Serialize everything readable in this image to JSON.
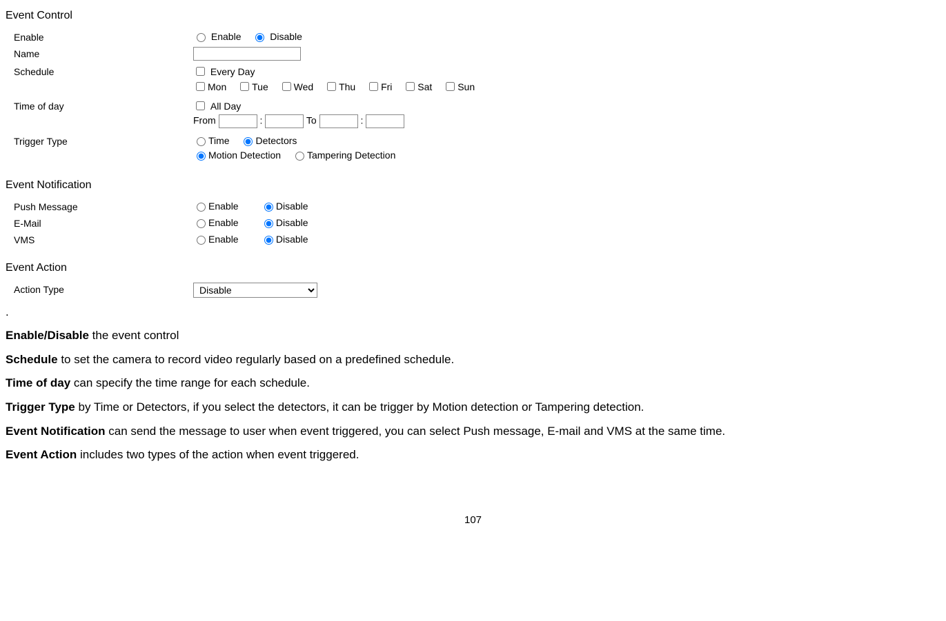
{
  "sections": {
    "eventControl": "Event Control",
    "eventNotification": "Event Notification",
    "eventAction": "Event Action"
  },
  "labels": {
    "enable": "Enable",
    "name": "Name",
    "schedule": "Schedule",
    "timeOfDay": "Time of day",
    "triggerType": "Trigger Type",
    "pushMessage": "Push Message",
    "email": "E-Mail",
    "vms": "VMS",
    "actionType": "Action Type"
  },
  "options": {
    "enable": "Enable",
    "disable": "Disable",
    "everyDay": "Every Day",
    "mon": "Mon",
    "tue": "Tue",
    "wed": "Wed",
    "thu": "Thu",
    "fri": "Fri",
    "sat": "Sat",
    "sun": "Sun",
    "allDay": "All Day",
    "from": "From",
    "to": "To",
    "time": "Time",
    "detectors": "Detectors",
    "motionDetection": "Motion Detection",
    "tamperingDetection": "Tampering Detection"
  },
  "values": {
    "name": "",
    "fromH": "",
    "fromM": "",
    "toH": "",
    "toM": "",
    "actionTypeSelected": "Disable"
  },
  "desc": {
    "dot": ".",
    "d1b": "Enable/Disable",
    "d1": " the event control",
    "d2b": "Schedule",
    "d2": " to set the camera to record video regularly based on a predefined schedule.",
    "d3b": "Time of day",
    "d3": " can specify the time range for each schedule.",
    "d4b": "Trigger Type",
    "d4": " by Time or Detectors, if you select the detectors, it can be trigger by Motion detection or Tampering detection.",
    "d5b": "Event Notification",
    "d5": " can send the message to user when event triggered, you can select Push message, E-mail and VMS at the same time.",
    "d6b": "Event Action",
    "d6": " includes two types of the action when event triggered."
  },
  "pageNum": "107"
}
